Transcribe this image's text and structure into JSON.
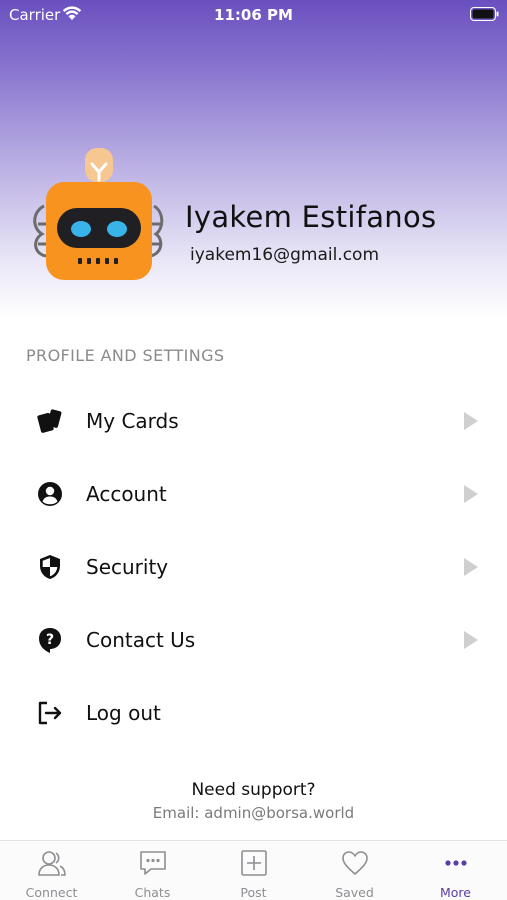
{
  "status_bar": {
    "carrier": "Carrier",
    "time": "11:06 PM",
    "wifi_icon": "wifi-icon",
    "battery_icon": "battery-icon"
  },
  "profile": {
    "name": "Iyakem Estifanos",
    "email": "iyakem16@gmail.com",
    "avatar_icon": "robot-avatar-icon"
  },
  "section": {
    "title": "PROFILE AND SETTINGS"
  },
  "menu": {
    "items": [
      {
        "label": "My Cards",
        "icon": "cards-icon",
        "has_chevron": true
      },
      {
        "label": "Account",
        "icon": "account-icon",
        "has_chevron": true
      },
      {
        "label": "Security",
        "icon": "shield-icon",
        "has_chevron": true
      },
      {
        "label": "Contact Us",
        "icon": "help-icon",
        "has_chevron": true
      },
      {
        "label": "Log out",
        "icon": "logout-icon",
        "has_chevron": false
      }
    ]
  },
  "support": {
    "title": "Need support?",
    "email": "Email: admin@borsa.world"
  },
  "tab_bar": {
    "tabs": [
      {
        "label": "Connect",
        "icon": "connect-icon",
        "active": false
      },
      {
        "label": "Chats",
        "icon": "chat-icon",
        "active": false
      },
      {
        "label": "Post",
        "icon": "post-icon",
        "active": false
      },
      {
        "label": "Saved",
        "icon": "heart-icon",
        "active": false
      },
      {
        "label": "More",
        "icon": "more-icon",
        "active": true
      }
    ]
  },
  "colors": {
    "accent": "#5b3ea6",
    "header_gradient_top": "#6a4fbf",
    "inactive_tab": "#8e8e93",
    "avatar_orange": "#f7931e"
  }
}
